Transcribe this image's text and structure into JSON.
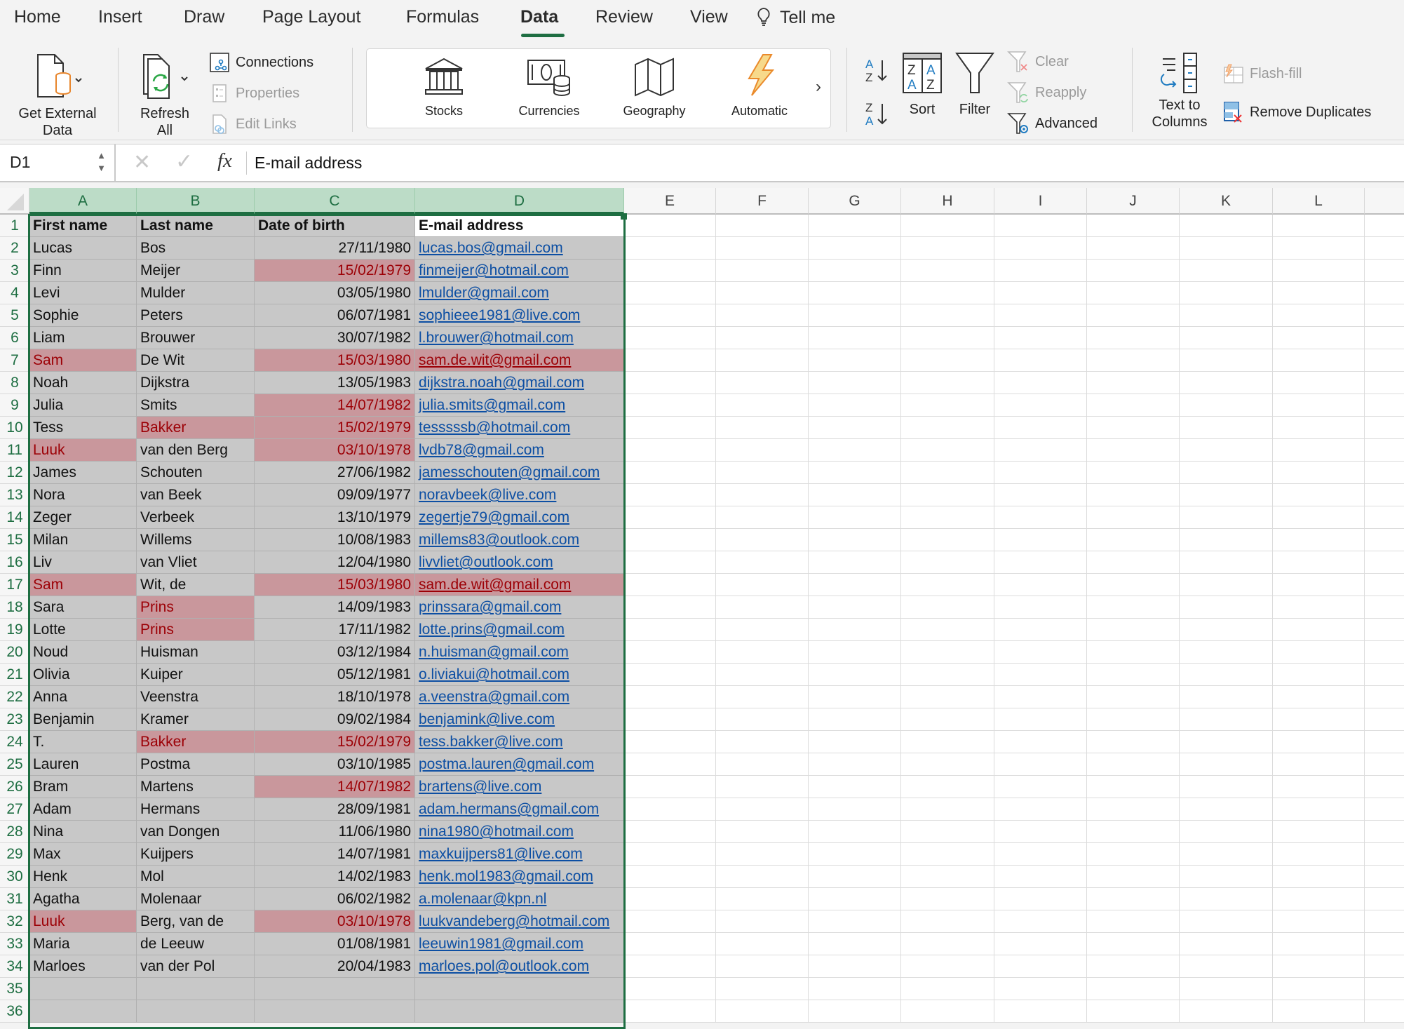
{
  "tabs": [
    {
      "label": "Home",
      "active": false
    },
    {
      "label": "Insert",
      "active": false
    },
    {
      "label": "Draw",
      "active": false
    },
    {
      "label": "Page Layout",
      "active": false
    },
    {
      "label": "Formulas",
      "active": false
    },
    {
      "label": "Data",
      "active": true
    },
    {
      "label": "Review",
      "active": false
    },
    {
      "label": "View",
      "active": false
    }
  ],
  "tell_me": "Tell me",
  "ribbon": {
    "get_external_data": "Get External Data",
    "get_external_data_l1": "Get External",
    "get_external_data_l2": "Data",
    "refresh_all_l1": "Refresh",
    "refresh_all_l2": "All",
    "connections": "Connections",
    "properties": "Properties",
    "edit_links": "Edit Links",
    "data_types": [
      {
        "label": "Stocks",
        "icon": "bank-icon"
      },
      {
        "label": "Currencies",
        "icon": "currency-icon"
      },
      {
        "label": "Geography",
        "icon": "map-icon"
      },
      {
        "label": "Automatic",
        "icon": "lightning-icon"
      }
    ],
    "sort_az": "A→Z",
    "sort_za": "Z→A",
    "sort": "Sort",
    "filter": "Filter",
    "clear": "Clear",
    "reapply": "Reapply",
    "advanced": "Advanced",
    "text_to_columns_l1": "Text to",
    "text_to_columns_l2": "Columns",
    "flash_fill": "Flash-fill",
    "remove_duplicates": "Remove Duplicates"
  },
  "formula_bar": {
    "name_box": "D1",
    "formula": "E-mail address"
  },
  "colors": {
    "accent": "#1e6e42",
    "highlight_fill": "#c9979c",
    "highlight_text": "#9c0006",
    "range_fill": "#c8c8c8",
    "link": "#0d4fa3"
  },
  "sheet": {
    "columns": [
      "A",
      "B",
      "C",
      "D",
      "E",
      "F",
      "G",
      "H",
      "I",
      "J",
      "K",
      "L"
    ],
    "selected_cell": "D1",
    "headers": [
      "First name",
      "Last name",
      "Date of birth",
      "E-mail address"
    ],
    "rows": [
      {
        "first": "Lucas",
        "last": "Bos",
        "dob": "27/11/1980",
        "email": "lucas.bos@gmail.com",
        "hl": []
      },
      {
        "first": "Finn",
        "last": "Meijer",
        "dob": "15/02/1979",
        "email": "finmeijer@hotmail.com",
        "hl": [
          "dob"
        ]
      },
      {
        "first": "Levi",
        "last": "Mulder",
        "dob": "03/05/1980",
        "email": "lmulder@gmail.com",
        "hl": []
      },
      {
        "first": "Sophie",
        "last": "Peters",
        "dob": "06/07/1981",
        "email": "sophieee1981@live.com",
        "hl": []
      },
      {
        "first": "Liam",
        "last": "Brouwer",
        "dob": "30/07/1982",
        "email": "l.brouwer@hotmail.com",
        "hl": []
      },
      {
        "first": "Sam",
        "last": "De Wit",
        "dob": "15/03/1980",
        "email": "sam.de.wit@gmail.com",
        "hl": [
          "first",
          "dob",
          "email"
        ]
      },
      {
        "first": "Noah",
        "last": "Dijkstra",
        "dob": "13/05/1983",
        "email": "dijkstra.noah@gmail.com",
        "hl": []
      },
      {
        "first": "Julia",
        "last": "Smits",
        "dob": "14/07/1982",
        "email": "julia.smits@gmail.com",
        "hl": [
          "dob"
        ]
      },
      {
        "first": "Tess",
        "last": "Bakker",
        "dob": "15/02/1979",
        "email": "tesssssb@hotmail.com",
        "hl": [
          "last",
          "dob"
        ]
      },
      {
        "first": "Luuk",
        "last": "van den Berg",
        "dob": "03/10/1978",
        "email": "lvdb78@gmail.com",
        "hl": [
          "first",
          "dob"
        ]
      },
      {
        "first": "James",
        "last": "Schouten",
        "dob": "27/06/1982",
        "email": "jamesschouten@gmail.com",
        "hl": []
      },
      {
        "first": "Nora",
        "last": "van Beek",
        "dob": "09/09/1977",
        "email": "noravbeek@live.com",
        "hl": []
      },
      {
        "first": "Zeger",
        "last": "Verbeek",
        "dob": "13/10/1979",
        "email": "zegertje79@gmail.com",
        "hl": []
      },
      {
        "first": "Milan",
        "last": "Willems",
        "dob": "10/08/1983",
        "email": "millems83@outlook.com",
        "hl": []
      },
      {
        "first": "Liv",
        "last": "van Vliet",
        "dob": "12/04/1980",
        "email": "livvliet@outlook.com",
        "hl": []
      },
      {
        "first": "Sam",
        "last": "Wit, de",
        "dob": "15/03/1980",
        "email": "sam.de.wit@gmail.com",
        "hl": [
          "first",
          "dob",
          "email"
        ]
      },
      {
        "first": "Sara",
        "last": "Prins",
        "dob": "14/09/1983",
        "email": "prinssara@gmail.com",
        "hl": [
          "last"
        ]
      },
      {
        "first": "Lotte",
        "last": "Prins",
        "dob": "17/11/1982",
        "email": "lotte.prins@gmail.com",
        "hl": [
          "last"
        ]
      },
      {
        "first": "Noud",
        "last": "Huisman",
        "dob": "03/12/1984",
        "email": "n.huisman@gmail.com",
        "hl": []
      },
      {
        "first": "Olivia",
        "last": "Kuiper",
        "dob": "05/12/1981",
        "email": "o.liviakui@hotmail.com",
        "hl": []
      },
      {
        "first": "Anna",
        "last": "Veenstra",
        "dob": "18/10/1978",
        "email": "a.veenstra@gmail.com",
        "hl": []
      },
      {
        "first": "Benjamin",
        "last": "Kramer",
        "dob": "09/02/1984",
        "email": "benjamink@live.com",
        "hl": []
      },
      {
        "first": "T.",
        "last": "Bakker",
        "dob": "15/02/1979",
        "email": "tess.bakker@live.com",
        "hl": [
          "last",
          "dob"
        ]
      },
      {
        "first": "Lauren",
        "last": "Postma",
        "dob": "03/10/1985",
        "email": "postma.lauren@gmail.com",
        "hl": []
      },
      {
        "first": "Bram",
        "last": "Martens",
        "dob": "14/07/1982",
        "email": "brartens@live.com",
        "hl": [
          "dob"
        ]
      },
      {
        "first": "Adam",
        "last": "Hermans",
        "dob": "28/09/1981",
        "email": "adam.hermans@gmail.com",
        "hl": []
      },
      {
        "first": "Nina",
        "last": "van Dongen",
        "dob": "11/06/1980",
        "email": "nina1980@hotmail.com",
        "hl": []
      },
      {
        "first": "Max",
        "last": "Kuijpers",
        "dob": "14/07/1981",
        "email": "maxkuijpers81@live.com",
        "hl": []
      },
      {
        "first": "Henk",
        "last": "Mol",
        "dob": "14/02/1983",
        "email": "henk.mol1983@gmail.com",
        "hl": []
      },
      {
        "first": "Agatha",
        "last": "Molenaar",
        "dob": "06/02/1982",
        "email": "a.molenaar@kpn.nl",
        "hl": []
      },
      {
        "first": "Luuk",
        "last": "Berg, van de",
        "dob": "03/10/1978",
        "email": "luukvandeberg@hotmail.com",
        "hl": [
          "first",
          "dob"
        ]
      },
      {
        "first": "Maria",
        "last": "de Leeuw",
        "dob": "01/08/1981",
        "email": "leeuwin1981@gmail.com",
        "hl": []
      },
      {
        "first": "Marloes",
        "last": "van der Pol",
        "dob": "20/04/1983",
        "email": "marloes.pol@outlook.com",
        "hl": []
      }
    ],
    "empty_row_numbers": [
      35,
      36
    ]
  }
}
